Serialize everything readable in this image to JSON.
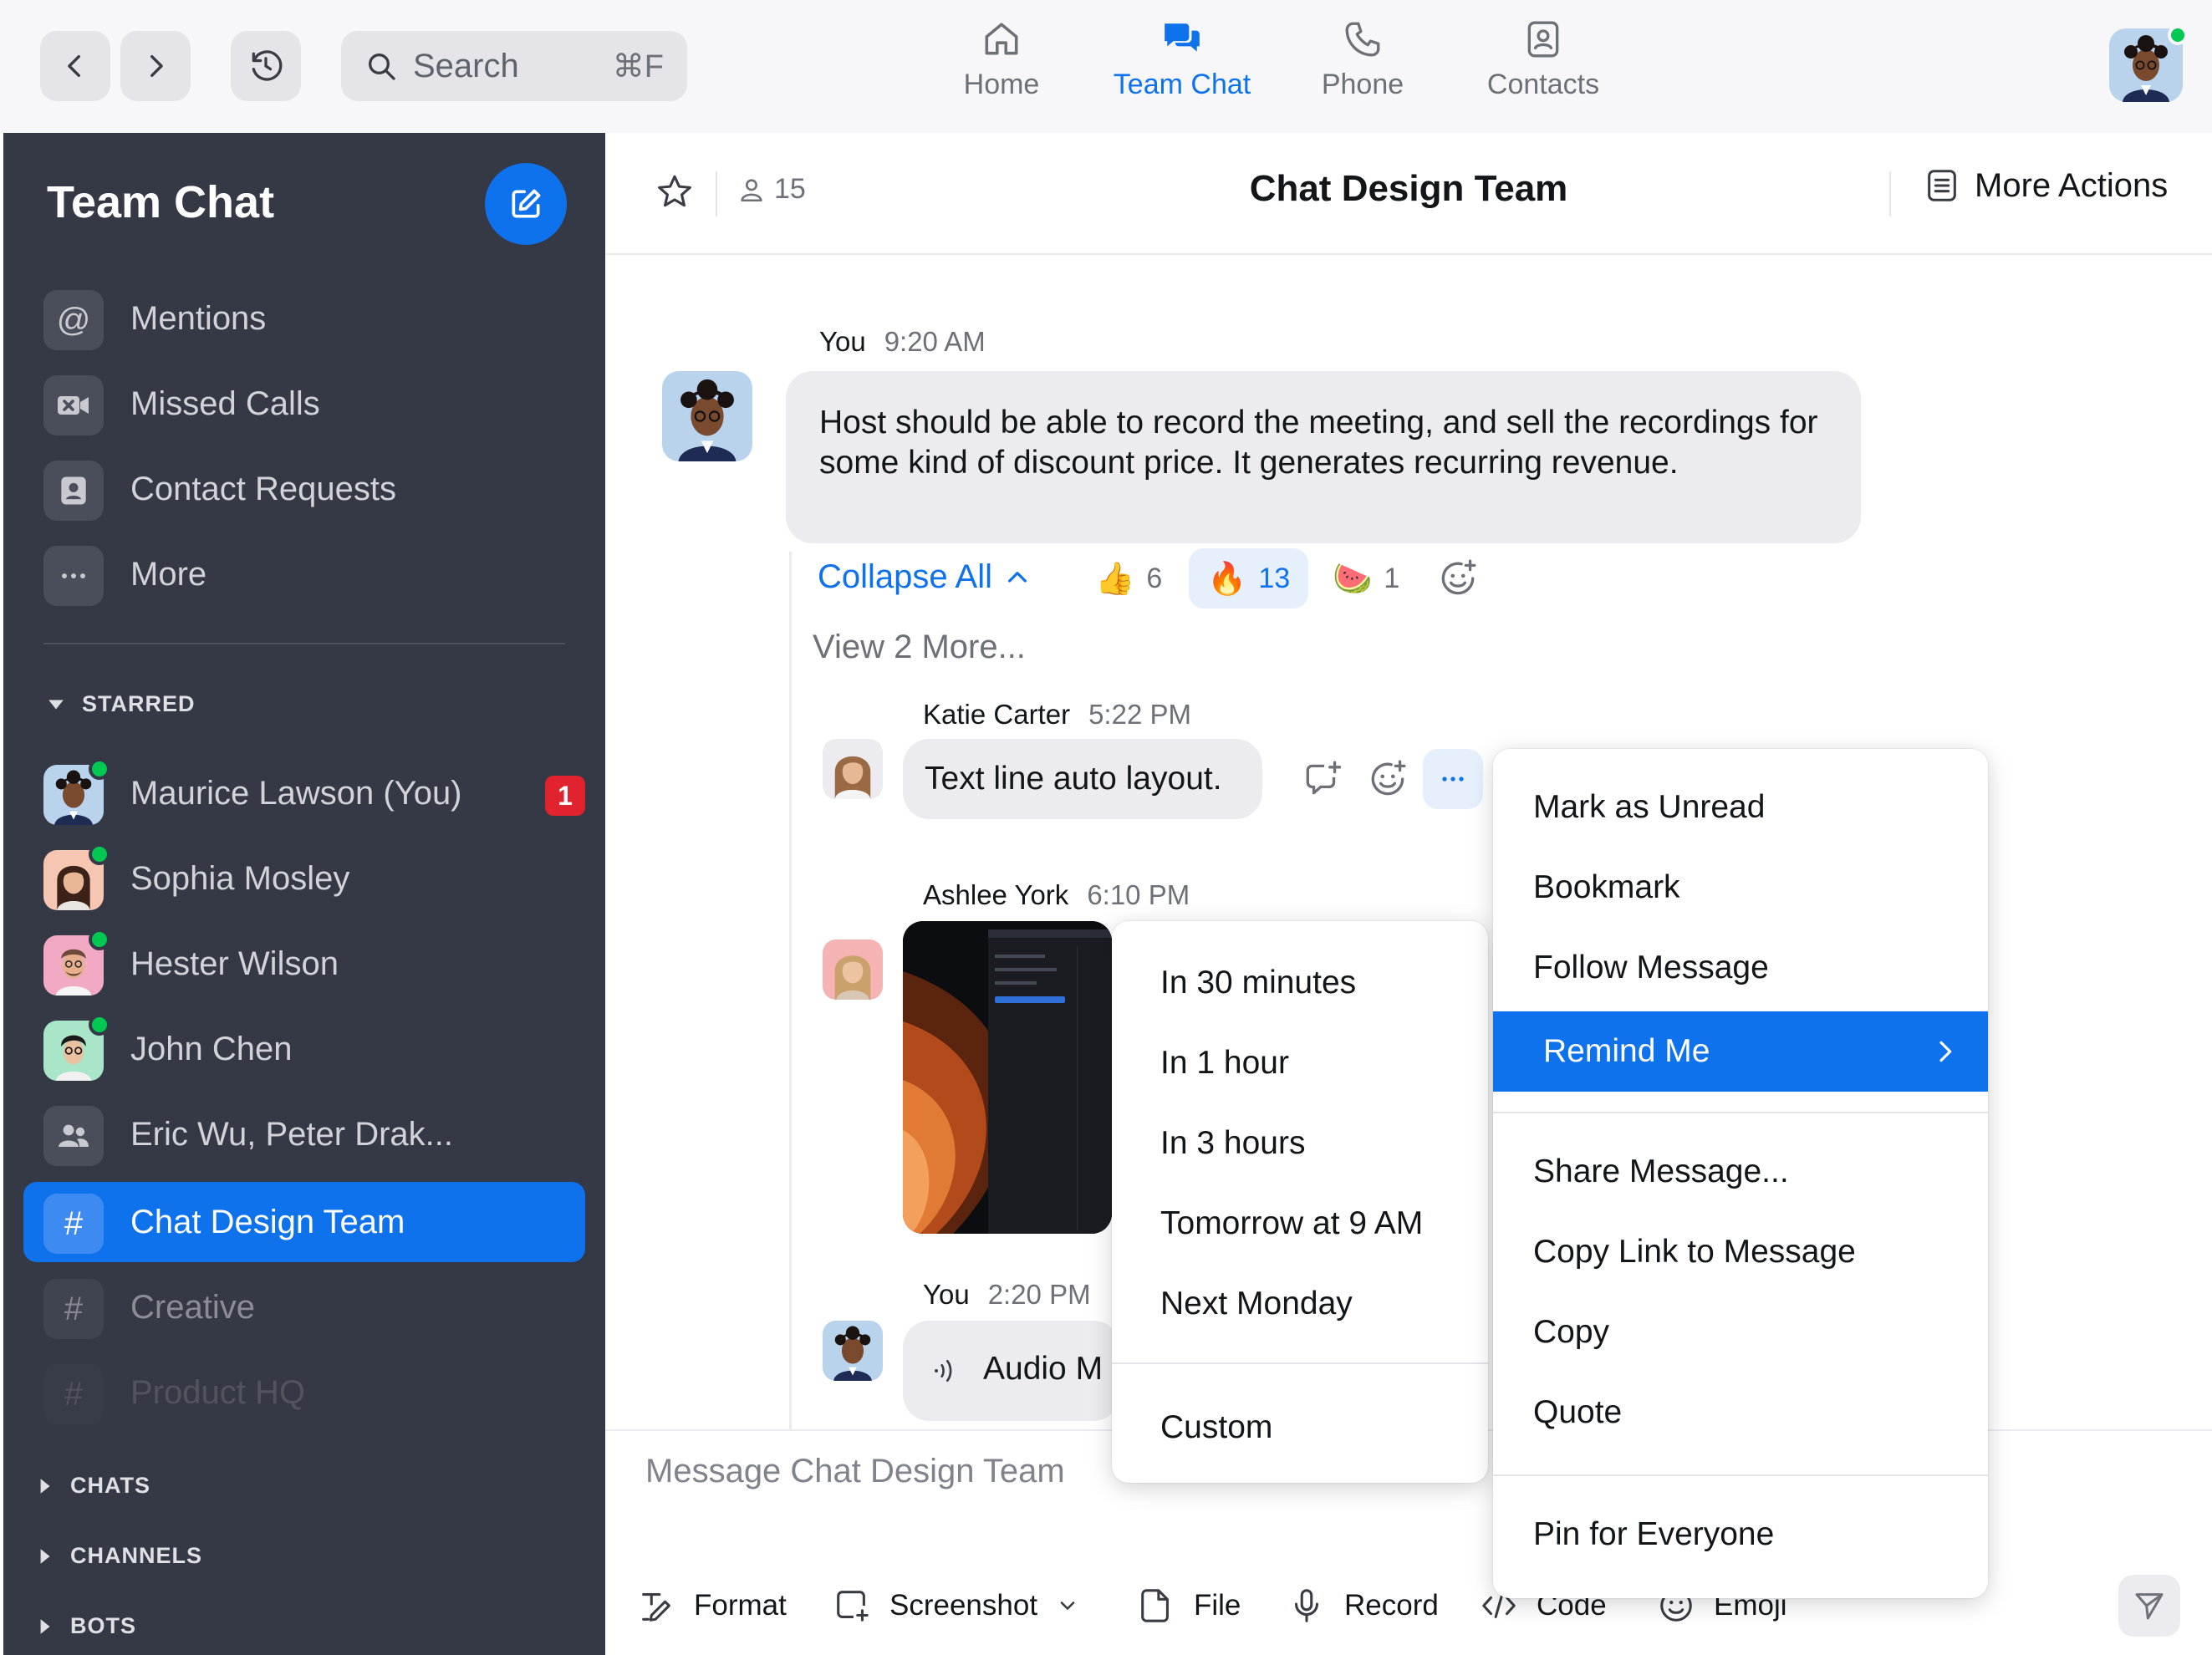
{
  "topbar": {
    "search_placeholder": "Search",
    "search_shortcut": "⌘F",
    "nav": [
      {
        "label": "Home",
        "icon": "home-icon"
      },
      {
        "label": "Team Chat",
        "icon": "team-chat-icon",
        "active": true
      },
      {
        "label": "Phone",
        "icon": "phone-icon"
      },
      {
        "label": "Contacts",
        "icon": "contacts-icon"
      }
    ],
    "presence": "online"
  },
  "sidebar": {
    "title": "Team Chat",
    "shortcuts": [
      {
        "label": "Mentions",
        "icon": "at-icon"
      },
      {
        "label": "Missed Calls",
        "icon": "missed-call-icon"
      },
      {
        "label": "Contact Requests",
        "icon": "contact-request-icon"
      },
      {
        "label": "More",
        "icon": "more-dots-icon"
      }
    ],
    "starred_label": "STARRED",
    "starred": [
      {
        "label": "Maurice Lawson (You)",
        "unread": "1",
        "online": true
      },
      {
        "label": "Sophia Mosley",
        "online": true
      },
      {
        "label": "Hester Wilson",
        "online": true
      },
      {
        "label": "John Chen",
        "online": true
      },
      {
        "label": "Eric Wu, Peter Drak...",
        "icon": "group-icon"
      },
      {
        "label": "Chat Design Team",
        "icon": "channel-hash-icon",
        "active": true
      },
      {
        "label": "Creative",
        "icon": "channel-hash-icon"
      },
      {
        "label": "Product HQ",
        "icon": "channel-hash-icon"
      }
    ],
    "sections": [
      "CHATS",
      "CHANNELS",
      "BOTS"
    ]
  },
  "channel": {
    "name": "Chat Design Team",
    "member_count": "15",
    "more_actions": "More Actions"
  },
  "messages": {
    "root": {
      "sender": "You",
      "time": "9:20 AM",
      "text": "Host should be able to record the meeting, and sell the recordings for some kind of discount price. It generates recurring revenue."
    },
    "collapse_all": "Collapse All",
    "reactions": [
      {
        "emoji": "👍",
        "count": "6"
      },
      {
        "emoji": "🔥",
        "count": "13",
        "selected": true
      },
      {
        "emoji": "🍉",
        "count": "1"
      }
    ],
    "view_more": "View 2 More...",
    "replies": [
      {
        "sender": "Katie Carter",
        "time": "5:22 PM",
        "text": "Text line auto layout."
      },
      {
        "sender": "Ashlee York",
        "time": "6:10 PM",
        "attachment": "image"
      },
      {
        "sender": "You",
        "time": "2:20 PM",
        "text": "Audio M"
      }
    ]
  },
  "composer": {
    "placeholder": "Message Chat Design Team",
    "tools": [
      "Format",
      "Screenshot",
      "File",
      "Record",
      "Code",
      "Emoji"
    ]
  },
  "context_menu": {
    "group1": [
      "Mark as Unread",
      "Bookmark",
      "Follow Message",
      "Remind Me"
    ],
    "group2": [
      "Share Message...",
      "Copy Link to Message",
      "Copy",
      "Quote"
    ],
    "group3": [
      "Pin for Everyone"
    ],
    "highlight_color": "#0E72ED"
  },
  "remind_submenu": {
    "options": [
      "In 30 minutes",
      "In 1 hour",
      "In 3 hours",
      "Tomorrow at 9 AM",
      "Next Monday"
    ],
    "custom": "Custom"
  },
  "colors": {
    "accent": "#0E72ED",
    "sidebar_bg": "#353845",
    "online": "#00C851",
    "badge": "#E0232E"
  }
}
